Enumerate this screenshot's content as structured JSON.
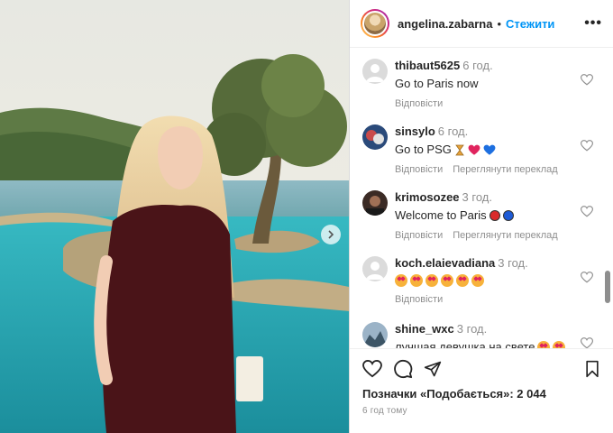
{
  "header": {
    "username": "angelina.zabarna",
    "dot": "•",
    "follow_label": "Стежити",
    "more_label": "•••"
  },
  "comments": [
    {
      "username": "thibaut5625",
      "time": "6 год.",
      "text": "Go to Paris now",
      "reply": "Відповісти",
      "translate": ""
    },
    {
      "username": "sinsylo",
      "time": "6 год.",
      "text": "Go to PSG",
      "text_symbols": [
        "hourglass-icon",
        "red-heart-icon",
        "blue-heart-icon"
      ],
      "reply": "Відповісти",
      "translate": "Переглянути переклад"
    },
    {
      "username": "krimosozee",
      "time": "3 год.",
      "text": "Welcome to Paris",
      "text_symbols": [
        "red-circle-icon",
        "blue-circle-icon"
      ],
      "reply": "Відповісти",
      "translate": "Переглянути переклад"
    },
    {
      "username": "koch.elaievadiana",
      "time": "3 год.",
      "text": "",
      "text_symbols": [
        "heart-eyes-emoji",
        "heart-eyes-emoji",
        "heart-eyes-emoji",
        "heart-eyes-emoji",
        "heart-eyes-emoji",
        "heart-eyes-emoji"
      ],
      "reply": "Відповісти",
      "translate": ""
    },
    {
      "username": "shine_wxc",
      "time": "3 год.",
      "text": "лучшая девушка на свете",
      "text_symbols": [
        "heart-eyes-emoji",
        "heart-eyes-emoji"
      ],
      "reply": "",
      "translate": ""
    }
  ],
  "footer": {
    "likes": "Позначки «Подобається»: 2 044",
    "posted": "6 год тому"
  },
  "colors": {
    "accent": "#0095f6",
    "muted": "#8e8e8e"
  }
}
